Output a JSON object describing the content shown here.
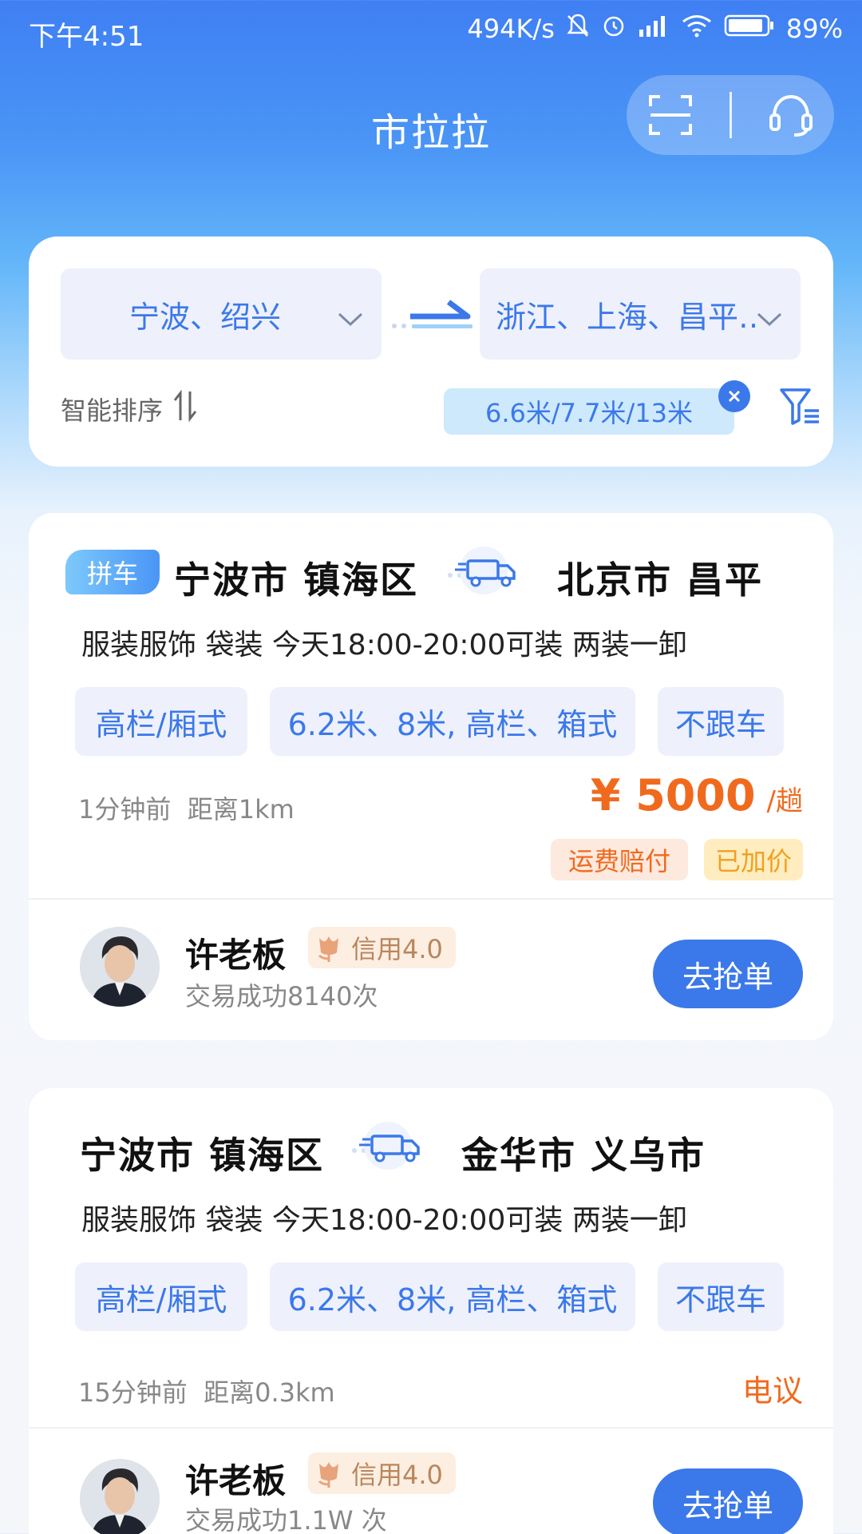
{
  "status_bar": {
    "time": "下午4:51",
    "net_speed": "494K/s",
    "battery": "89%"
  },
  "header": {
    "title": "市拉拉",
    "icons": [
      "scan-icon",
      "headset-icon"
    ]
  },
  "filter": {
    "from_city": "宁波、绍兴",
    "to_city": "浙江、上海、昌平…",
    "sort_label": "智能排序",
    "selected_chip": "6.6米/7.7米/13米"
  },
  "orders": [
    {
      "tag": "拼车",
      "from": "宁波市 镇海区",
      "to": "北京市 昌平",
      "desc": "服装服饰  袋装   今天18:00-20:00可装  两装一卸",
      "chips": [
        "高栏/厢式",
        "6.2米、8米, 高栏、箱式",
        "不跟车"
      ],
      "time_ago": "1分钟前",
      "distance": "距离1km",
      "price_amount": "¥ 5000",
      "price_unit": "/趟",
      "badges": [
        "运费赔付",
        "已加价"
      ],
      "boss": "许老板",
      "credit": "信用4.0",
      "trades": "交易成功8140次",
      "action": "去抢单"
    },
    {
      "from": "宁波市 镇海区",
      "to": "金华市 义乌市",
      "desc": "服装服饰  袋装   今天18:00-20:00可装  两装一卸",
      "chips": [
        "高栏/厢式",
        "6.2米、8米, 高栏、箱式",
        "不跟车"
      ],
      "time_ago": "15分钟前",
      "distance": "距离0.3km",
      "price_text": "电议",
      "boss": "许老板",
      "credit": "信用4.0",
      "trades": "交易成功1.1W 次",
      "action": "去抢单"
    }
  ],
  "colors": {
    "primary": "#3b78ea",
    "price": "#f06a1e",
    "chip_bg": "#eef1fb"
  }
}
